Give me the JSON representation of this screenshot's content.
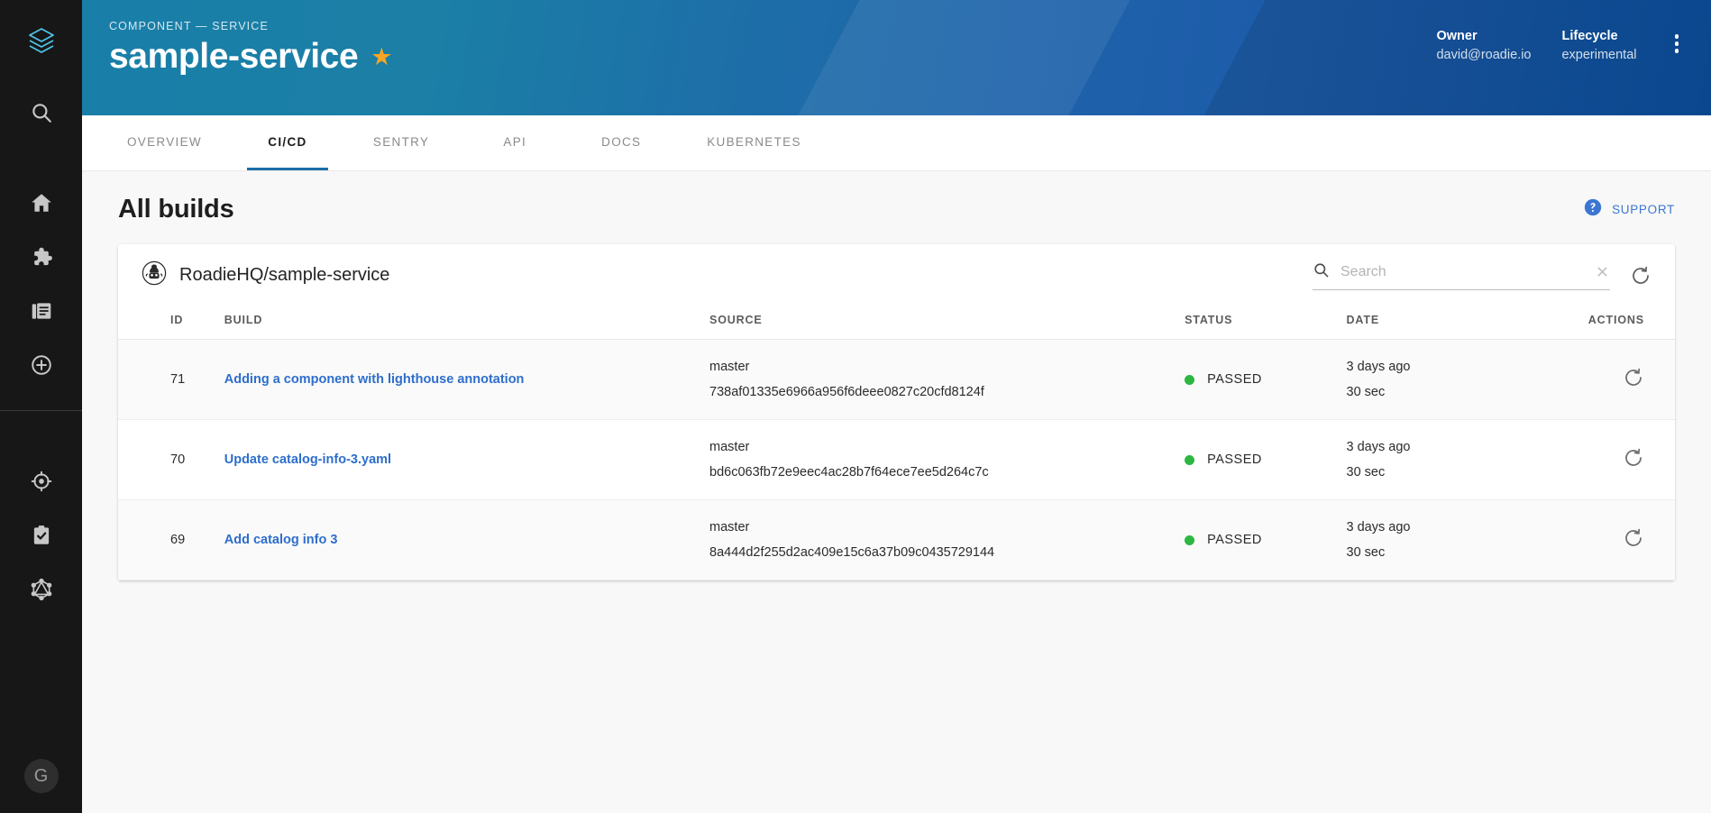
{
  "sidebar": {
    "logo_icon": "backstage-logo-icon",
    "items": [
      {
        "icon": "search-icon",
        "name": "sidebar-item-search"
      },
      {
        "icon": "home-icon",
        "name": "sidebar-item-home"
      },
      {
        "icon": "puzzle-icon",
        "name": "sidebar-item-apis"
      },
      {
        "icon": "docs-icon",
        "name": "sidebar-item-docs"
      },
      {
        "icon": "plus-circle-icon",
        "name": "sidebar-item-create"
      },
      {
        "icon": "radar-icon",
        "name": "sidebar-item-tech-radar"
      },
      {
        "icon": "clipboard-check-icon",
        "name": "sidebar-item-tech-insights"
      },
      {
        "icon": "graphql-icon",
        "name": "sidebar-item-graphql"
      }
    ],
    "avatar_label": "G"
  },
  "header": {
    "eyebrow": "COMPONENT — SERVICE",
    "title": "sample-service",
    "star_icon": "star-icon",
    "owner_label": "Owner",
    "owner_value": "david@roadie.io",
    "lifecycle_label": "Lifecycle",
    "lifecycle_value": "experimental",
    "more_icon": "kebab-menu-icon"
  },
  "tabs": [
    {
      "label": "Overview",
      "active": false
    },
    {
      "label": "CI/CD",
      "active": true
    },
    {
      "label": "Sentry",
      "active": false
    },
    {
      "label": "API",
      "active": false
    },
    {
      "label": "Docs",
      "active": false
    },
    {
      "label": "Kubernetes",
      "active": false
    }
  ],
  "content": {
    "heading": "All builds",
    "support_label": "Support",
    "support_icon": "help-circle-icon"
  },
  "card": {
    "repo_icon": "github-avatar-icon",
    "repo_name": "RoadieHQ/sample-service",
    "search": {
      "placeholder": "Search",
      "value": "",
      "icon": "search-icon",
      "clear_icon": "close-icon"
    },
    "refresh_icon": "refresh-icon",
    "columns": [
      "ID",
      "Build",
      "Source",
      "Status",
      "Date",
      "Actions"
    ],
    "rows": [
      {
        "id": "71",
        "build": "Adding a component with lighthouse annotation",
        "branch": "master",
        "hash": "738af01335e6966a956f6deee0827c20cfd8124f",
        "status": "PASSED",
        "status_color": "#2cb742",
        "date": "3 days ago",
        "duration": "30 sec",
        "action_icon": "retry-icon"
      },
      {
        "id": "70",
        "build": "Update catalog-info-3.yaml",
        "branch": "master",
        "hash": "bd6c063fb72e9eec4ac28b7f64ece7ee5d264c7c",
        "status": "PASSED",
        "status_color": "#2cb742",
        "date": "3 days ago",
        "duration": "30 sec",
        "action_icon": "retry-icon"
      },
      {
        "id": "69",
        "build": "Add catalog info 3",
        "branch": "master",
        "hash": "8a444d2f255d2ac409e15c6a37b09c0435729144",
        "status": "PASSED",
        "status_color": "#2cb742",
        "date": "3 days ago",
        "duration": "30 sec",
        "action_icon": "retry-icon"
      }
    ]
  }
}
